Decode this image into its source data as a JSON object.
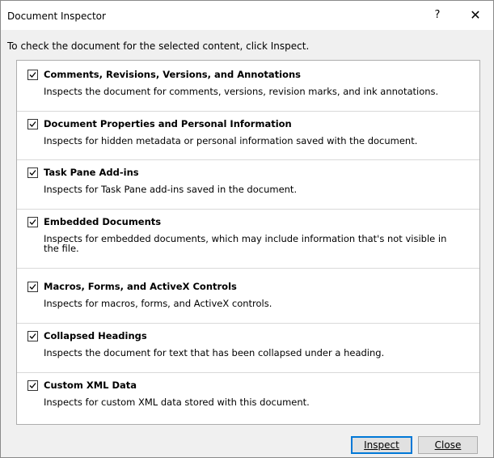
{
  "window": {
    "title": "Document Inspector",
    "help_label": "?",
    "close_label": "✕"
  },
  "instructions": "To check the document for the selected content, click Inspect.",
  "items": [
    {
      "name": "Comments, Revisions, Versions, and Annotations",
      "checked": true,
      "description": "Inspects the document for comments, versions, revision marks, and ink annotations."
    },
    {
      "name": "Document Properties and Personal Information",
      "checked": true,
      "description": "Inspects for hidden metadata or personal information saved with the document."
    },
    {
      "name": "Task Pane Add-ins",
      "checked": true,
      "description": "Inspects for Task Pane add-ins saved in the document."
    },
    {
      "name": "Embedded Documents",
      "checked": true,
      "description": "Inspects for embedded documents, which may include information that's not visible in the file."
    },
    {
      "name": "Macros, Forms, and ActiveX Controls",
      "checked": true,
      "description": "Inspects for macros, forms, and ActiveX controls."
    },
    {
      "name": "Collapsed Headings",
      "checked": true,
      "description": "Inspects the document for text that has been collapsed under a heading."
    },
    {
      "name": "Custom XML Data",
      "checked": true,
      "description": "Inspects for custom XML data stored with this document."
    }
  ],
  "scrollbar": {
    "up_icon": "chevron-up-icon",
    "down_icon": "chevron-down-icon"
  },
  "buttons": {
    "inspect_label": "Inspect",
    "close_label": "Close"
  }
}
